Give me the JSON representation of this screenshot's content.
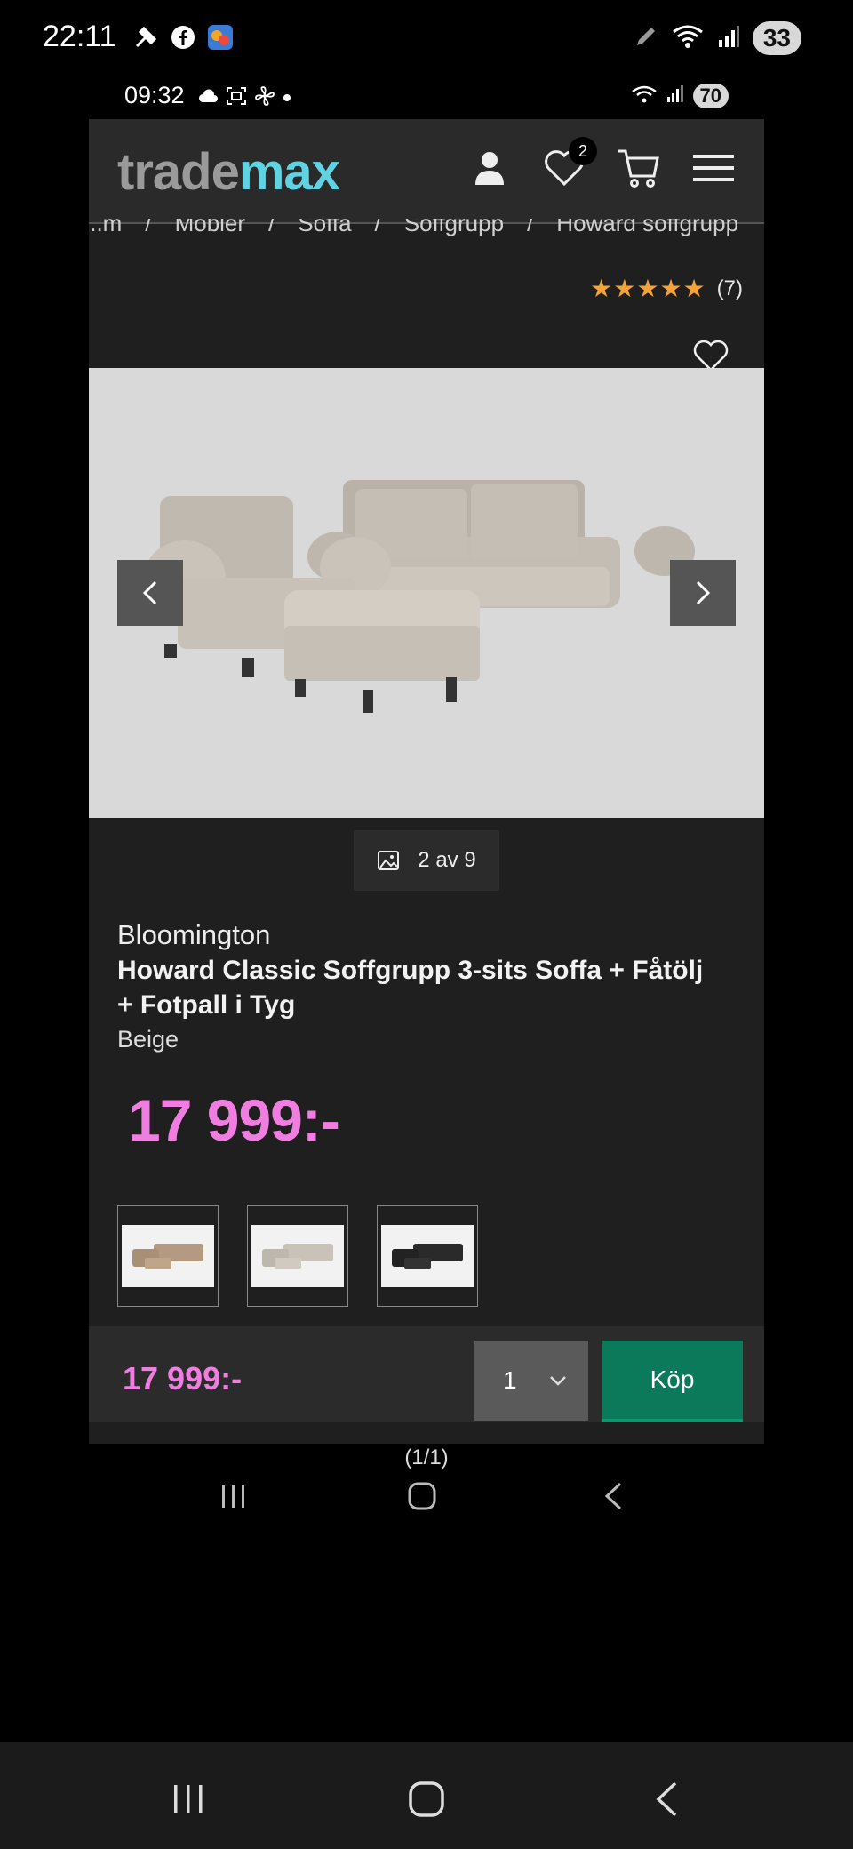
{
  "outer_status": {
    "time": "22:11",
    "battery": "33"
  },
  "inner_status": {
    "time": "09:32",
    "battery": "70"
  },
  "header": {
    "logo_part1": "trade",
    "logo_part2": "max",
    "wishlist_count": "2"
  },
  "breadcrumbs": [
    "...m",
    "/",
    "Möbler",
    "/",
    "Soffa",
    "/",
    "Soffgrupp",
    "/",
    "Howard soffgrupp"
  ],
  "rating": {
    "stars": "★★★★★",
    "count": "(7)"
  },
  "gallery": {
    "counter": "2 av 9"
  },
  "product": {
    "brand": "Bloomington",
    "name": "Howard Classic Soffgrupp 3-sits Soffa + Fåtölj + Fotpall i Tyg",
    "color": "Beige",
    "price": "17 999:-"
  },
  "variants": [
    {
      "name": "beige-brown"
    },
    {
      "name": "beige-light"
    },
    {
      "name": "black"
    }
  ],
  "buybar": {
    "price": "17 999:-",
    "quantity": "1",
    "buy_label": "Köp"
  },
  "inner_nav": {
    "pager": "(1/1)"
  },
  "colors": {
    "accent_pink": "#f07ee0",
    "buy_green": "#0a7a5a",
    "logo_cyan": "#5fd3e2",
    "star": "#f2a33a"
  }
}
